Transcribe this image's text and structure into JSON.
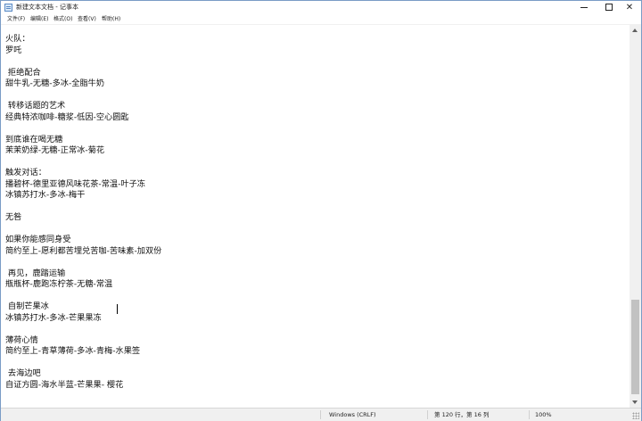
{
  "window": {
    "title": "新建文本文档 - 记事本",
    "minimize": "",
    "maximize": "",
    "close": "✕"
  },
  "menu": {
    "items": [
      "文件(F)",
      "编辑(E)",
      "格式(O)",
      "查看(V)",
      "帮助(H)"
    ]
  },
  "editor": {
    "lines": [
      "火队：",
      "罗吒",
      "",
      " 拒绝配合",
      "甜牛乳-无糖-多冰-全脂牛奶",
      "",
      " 转移话题的艺术",
      "经典特浓咖啡-糖浆-低因-空心圆匙",
      "",
      "到底谁在喝无糖",
      "茉茉奶绿-无糖-正常冰-菊花",
      "",
      "触发对话：",
      "播碧杯-德里亚德风味花茶-常温-叶子冻",
      "冰镇苏打水-多冰-梅干",
      "",
      "无咎",
      "",
      "如果你能感同身受",
      "简约至上-愿利都苦埋兑苦咖-苦味素-加双份",
      "",
      " 再见，鹿踏运输",
      "瓶瓶杯-鹿跑冻柠茶-无糖-常温",
      "",
      " 自制芒果冰",
      "冰镇苏打水-多冰-芒果果冻",
      "",
      "薄荷心情",
      "简约至上-青草薄荷-多冰-青梅-水果签",
      "",
      " 去海边吧",
      "自证方圆-海水半蓝-芒果果- 樱花"
    ]
  },
  "statusbar": {
    "encoding": "Windows (CRLF)",
    "position": "第 120 行，第 16 列",
    "zoom": "100%"
  }
}
